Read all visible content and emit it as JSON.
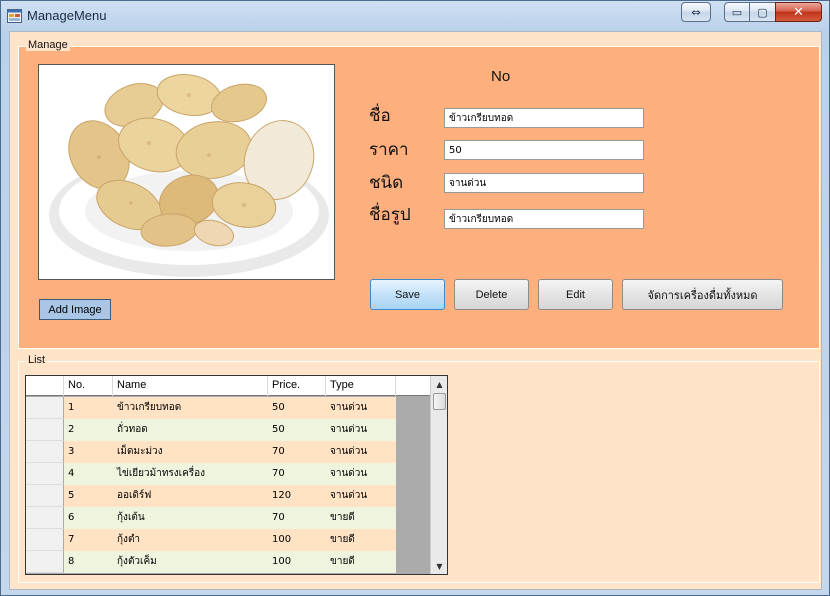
{
  "window": {
    "title": "ManageMenu",
    "controls": {
      "restore_alt": "⇔",
      "minimize": "▭",
      "maximize": "▢",
      "close": "✕"
    }
  },
  "manage": {
    "legend": "Manage",
    "no_label": "No",
    "add_image_label": "Add Image",
    "fields": [
      {
        "label": "ชื่อ",
        "value": "ข้าวเกรียบทอด"
      },
      {
        "label": "ราคา",
        "value": "50"
      },
      {
        "label": "ชนิด",
        "value": "จานด่วน"
      },
      {
        "label": "ชื่อรูป",
        "value": "ข้าวเกรียบทอด"
      }
    ],
    "buttons": {
      "save": "Save",
      "delete": "Delete",
      "edit": "Edit",
      "manage_all": "จัดการเครื่องดื่มทั้งหมด"
    }
  },
  "list": {
    "legend": "List",
    "columns": [
      "No.",
      "Name",
      "Price.",
      "Type"
    ],
    "rows": [
      {
        "no": "1",
        "name": "ข้าวเกรียบทอด",
        "price": "50",
        "type": "จานด่วน"
      },
      {
        "no": "2",
        "name": "ถั่วทอด",
        "price": "50",
        "type": "จานด่วน"
      },
      {
        "no": "3",
        "name": "เม็ดมะม่วง",
        "price": "70",
        "type": "จานด่วน"
      },
      {
        "no": "4",
        "name": "ไข่เยียวม้าทรงเครื่อง",
        "price": "70",
        "type": "จานด่วน"
      },
      {
        "no": "5",
        "name": "ออเดิร์ฟ",
        "price": "120",
        "type": "จานด่วน"
      },
      {
        "no": "6",
        "name": "กุ้งเต้น",
        "price": "70",
        "type": "ขายดี"
      },
      {
        "no": "7",
        "name": "กุ้งตำ",
        "price": "100",
        "type": "ขายดี"
      },
      {
        "no": "8",
        "name": "กุ้งตัวเค็ม",
        "price": "100",
        "type": "ขายดี"
      }
    ],
    "scroll": {
      "up": "▲",
      "down": "▼"
    }
  },
  "colors": {
    "manage_background": "#fdb07d",
    "client_background": "#ffe4c9",
    "row_odd": "#ffe3c4",
    "row_even": "#eef5de",
    "default_button": "#a9d4f4"
  },
  "icons": {
    "app": "form-window-icon",
    "picture": "crackers-plate-image"
  }
}
